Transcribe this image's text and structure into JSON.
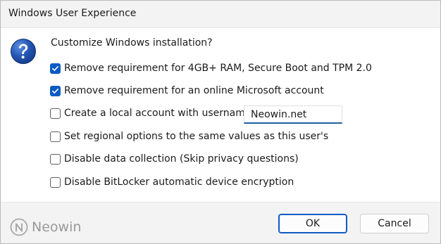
{
  "window": {
    "title": "Windows User Experience"
  },
  "icons": {
    "dialog_icon": "question-icon",
    "check": "checkmark-icon"
  },
  "colors": {
    "accent": "#0a5bc4",
    "title_bar": "#f3f3f3",
    "footer": "#f3f3f3",
    "question_icon": "#1c4fa8"
  },
  "dialog": {
    "prompt": "Customize Windows installation?",
    "options": [
      {
        "label": "Remove requirement for 4GB+ RAM, Secure Boot and TPM 2.0",
        "checked": true
      },
      {
        "label": "Remove requirement for an online Microsoft account",
        "checked": true
      },
      {
        "label": "Create a local account with username:",
        "checked": false
      },
      {
        "label": "Set regional options to the same values as this user's",
        "checked": false
      },
      {
        "label": "Disable data collection (Skip privacy questions)",
        "checked": false
      },
      {
        "label": "Disable BitLocker automatic device encryption",
        "checked": false
      }
    ],
    "username_value": "Neowin.net"
  },
  "footer": {
    "watermark": "Neowin",
    "ok_label": "OK",
    "cancel_label": "Cancel"
  }
}
